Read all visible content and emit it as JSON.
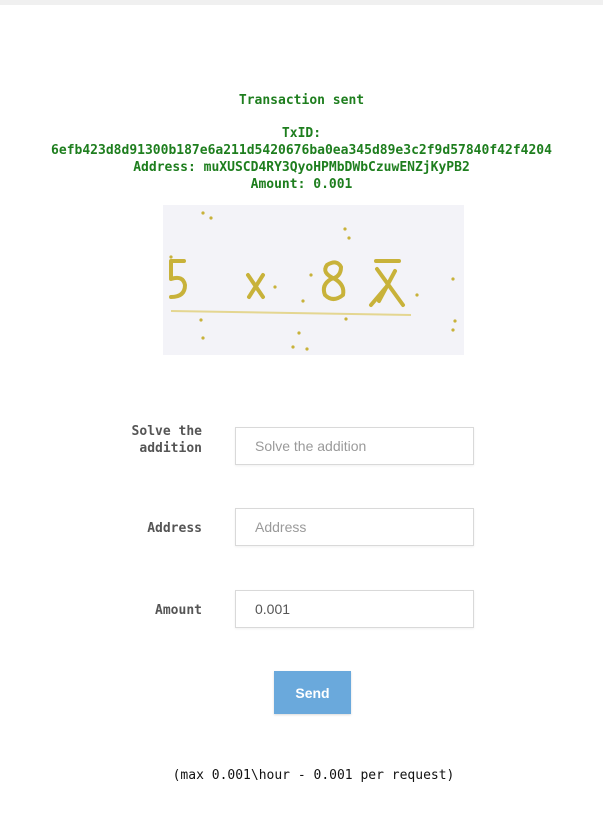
{
  "status": {
    "title": "Transaction sent",
    "txid_label": "TxID:",
    "txid": "6efb423d8d91300b187e6a211d5420676ba0ea345d89e3c2f9d57840f42f4204",
    "address_line": "Address: muXUSCD4RY3QyoHPMbDWbCzuwENZjKyPB2",
    "amount_line": "Amount: 0.001",
    "color": "#1e7e1e"
  },
  "captcha": {
    "text": "5 + 8 7",
    "background": "#f3f3f8",
    "ink": "#c8b23a"
  },
  "form": {
    "captcha_label": "Solve the addition",
    "captcha_placeholder": "Solve the addition",
    "captcha_value": "",
    "address_label": "Address",
    "address_placeholder": "Address",
    "address_value": "",
    "amount_label": "Amount",
    "amount_placeholder": "",
    "amount_value": "0.001",
    "send_label": "Send",
    "send_color": "#6aa9dc"
  },
  "note": "(max 0.001\\hour - 0.001 per request)"
}
